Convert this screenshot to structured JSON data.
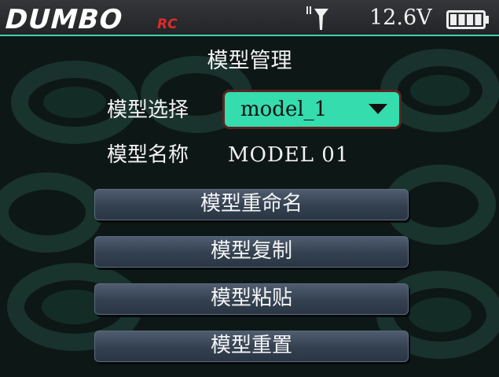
{
  "header": {
    "logo_text": "DUMBO",
    "logo_sub": "RC",
    "voltage": "12.6V",
    "battery_level": 1.0,
    "signal_icon": "antenna-icon"
  },
  "title": "模型管理",
  "select_row": {
    "label": "模型选择",
    "value": "model_1"
  },
  "name_row": {
    "label": "模型名称",
    "value": "MODEL 01"
  },
  "menu": {
    "rename": "模型重命名",
    "copy": "模型复制",
    "paste": "模型粘贴",
    "reset": "模型重置"
  },
  "colors": {
    "accent": "#35dcad",
    "button": "#3b4859",
    "background": "#0d1715"
  }
}
